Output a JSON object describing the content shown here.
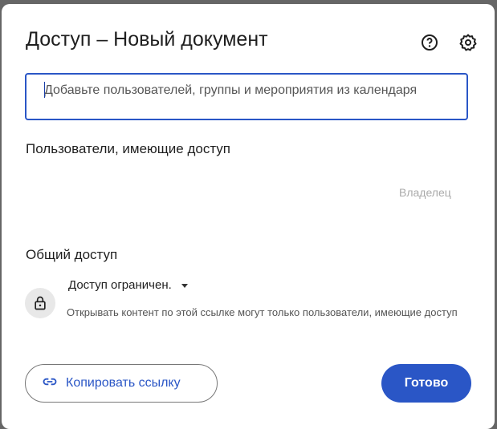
{
  "dialog": {
    "title": "Доступ – Новый документ",
    "help_icon": "help-circle-icon",
    "settings_icon": "gear-icon",
    "input": {
      "placeholder": "Добавьте пользователей, группы и мероприятия из календаря"
    },
    "people_heading": "Пользователи, имеющие доступ",
    "owner_label": "Владелец",
    "general_heading": "Общий доступ",
    "access": {
      "label": "Доступ ограничен.",
      "description": "Открывать контент по этой ссылке могут только пользователи, имеющие доступ"
    },
    "copy_link_label": "Копировать ссылку",
    "done_label": "Готово",
    "accent": "#2a56c6"
  }
}
